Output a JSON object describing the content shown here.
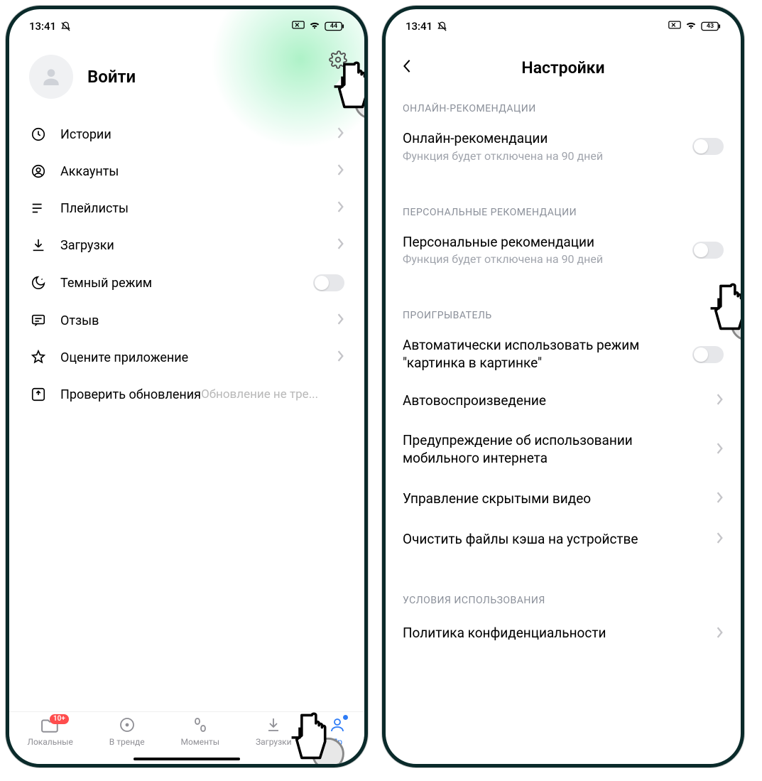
{
  "status": {
    "time": "13:41",
    "battery_left": "44",
    "battery_right": "43"
  },
  "left": {
    "login_label": "Войти",
    "menu": {
      "history": "Истории",
      "accounts": "Аккаунты",
      "playlists": "Плейлисты",
      "downloads": "Загрузки",
      "dark_mode": "Темный режим",
      "feedback": "Отзыв",
      "rate": "Оцените приложение",
      "updates": "Проверить обновления",
      "updates_sub": "Обновление не тре..."
    },
    "nav": {
      "local": "Локальные",
      "trending": "В тренде",
      "moments": "Моменты",
      "downloads": "Загрузки",
      "profile": "Пр",
      "badge": "10+"
    }
  },
  "right": {
    "title": "Настройки",
    "sections": {
      "online_header": "ОНЛАЙН-РЕКОМЕНДАЦИИ",
      "online_title": "Онлайн-рекомендации",
      "online_sub": "Функция будет отключена на 90 дней",
      "personal_header": "ПЕРСОНАЛЬНЫЕ РЕКОМЕНДАЦИИ",
      "personal_title": "Персональные рекомендации",
      "personal_sub": "Функция будет отключена на 90 дней",
      "player_header": "ПРОИГРЫВАТЕЛЬ",
      "pip": "Автоматически использовать режим \"картинка в картинке\"",
      "autoplay": "Автовоспроизведение",
      "mobile_warn": "Предупреждение об использовании мобильного интернета",
      "hidden": "Управление скрытыми видео",
      "clear_cache": "Очистить файлы кэша на устройстве",
      "terms_header": "УСЛОВИЯ ИСПОЛЬЗОВАНИЯ",
      "privacy": "Политика конфиденциальности"
    }
  }
}
